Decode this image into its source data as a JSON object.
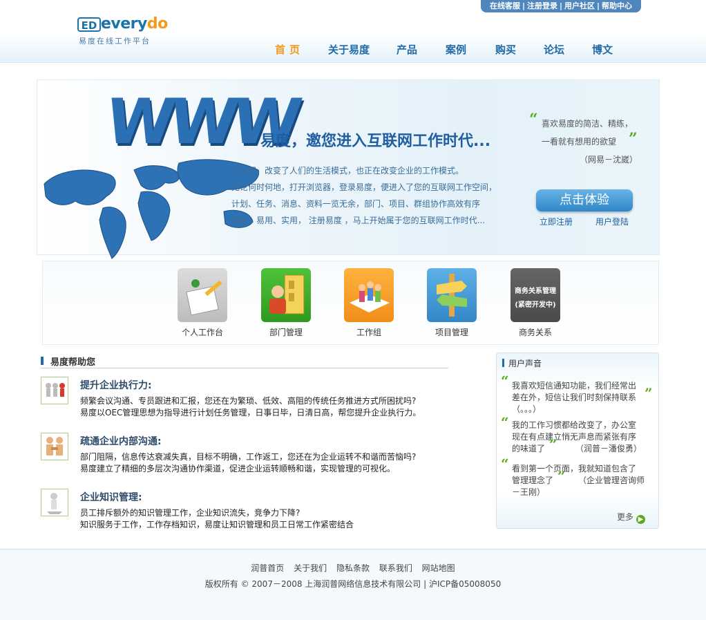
{
  "header": {
    "top_links": [
      "在线客服",
      "注册登录",
      "用户社区",
      "帮助中心"
    ],
    "logo": {
      "badge": "ED",
      "word_prefix": "every",
      "word_suffix": "do",
      "tagline": "易度在线工作平台"
    },
    "nav": [
      "首页",
      "关于易度",
      "产品",
      "案例",
      "购买",
      "论坛",
      "博文"
    ]
  },
  "banner": {
    "big_text": "WWW",
    "title": "易度，邀您进入互联网工作时代...",
    "lines": [
      "互联网，改变了人们的生活模式，也正在改变企业的工作模式。",
      "无论何时何地，打开浏览器，登录易度，便进入了您的互联网工作空间，",
      "计划、任务、消息、资料一览无余，部门、项目、群组协作高效有序",
      "简单、易用、实用，  注册易度  ，马上开始属于您的互联网工作时代..."
    ],
    "quote_lines": [
      "喜欢易度的简洁、精练，",
      "一看就有想用的欲望"
    ],
    "quote_author": "（网易－沈崴）",
    "cta_label": "点击体验",
    "register_label": "立即注册",
    "login_label": "用户登陆"
  },
  "features": [
    {
      "label": "个人工作台",
      "icon": "personal-desk-icon",
      "color": "#c9c9c9"
    },
    {
      "label": "部门管理",
      "icon": "department-icon",
      "color": "#3fae2a"
    },
    {
      "label": "工作组",
      "icon": "workgroup-icon",
      "color": "#f5a12a"
    },
    {
      "label": "项目管理",
      "icon": "project-icon",
      "color": "#4f9fd8"
    },
    {
      "label": "商务关系",
      "icon": "business-icon",
      "color": "#555555",
      "icon_text": [
        "商务关系管理",
        "(紧密开发中)"
      ]
    }
  ],
  "help": {
    "title": "易度帮助您",
    "items": [
      {
        "heading": "提升企业执行力:",
        "lines": [
          "频繁会议沟通、专员跟进和汇报，您还在为繁琐、低效、高阻的传统任务推进方式所困扰吗?",
          "易度以OEC管理思想为指导进行计划任务管理，日事日毕，日清日高，帮您提升企业执行力。"
        ]
      },
      {
        "heading": "疏通企业内部沟通:",
        "lines": [
          "部门阻隔，信息传达衰减失真，目标不明确，工作返工，您还在为企业运转不和谐而苦恼吗?",
          "易度建立了精细的多层次沟通协作渠道，促进企业运转顺畅和谐，实现管理的可视化。"
        ]
      },
      {
        "heading": "企业知识管理:",
        "lines": [
          "员工排斥额外的知识管理工作，企业知识流失，竞争力下降?",
          "知识服务于工作，工作存档知识，易度让知识管理和员工日常工作紧密结合"
        ]
      }
    ]
  },
  "voice": {
    "title": "用户声音",
    "quotes": [
      {
        "lines": [
          "我喜欢短信通知功能，我们经常出",
          "差在外，短信让我们时刻保持联系",
          "（。。。）"
        ]
      },
      {
        "lines": [
          "我的工作习惯都给改变了，办公室",
          "现在有点建立悄无声息而紧张有序",
          "的味道了",
          "（润普－潘俊勇）"
        ]
      },
      {
        "lines": [
          "看到第一个页面，我就知道包含了",
          "管理理念了",
          "（企业管理咨询师",
          "－王刚）"
        ]
      }
    ],
    "more": "更多"
  },
  "footer": {
    "links": [
      "润普首页",
      "关于我们",
      "隐私条款",
      "联系我们",
      "网站地图"
    ],
    "copyright": "版权所有 © 2007－2008 上海润普网络信息技术有限公司  |  沪ICP备05008050"
  }
}
